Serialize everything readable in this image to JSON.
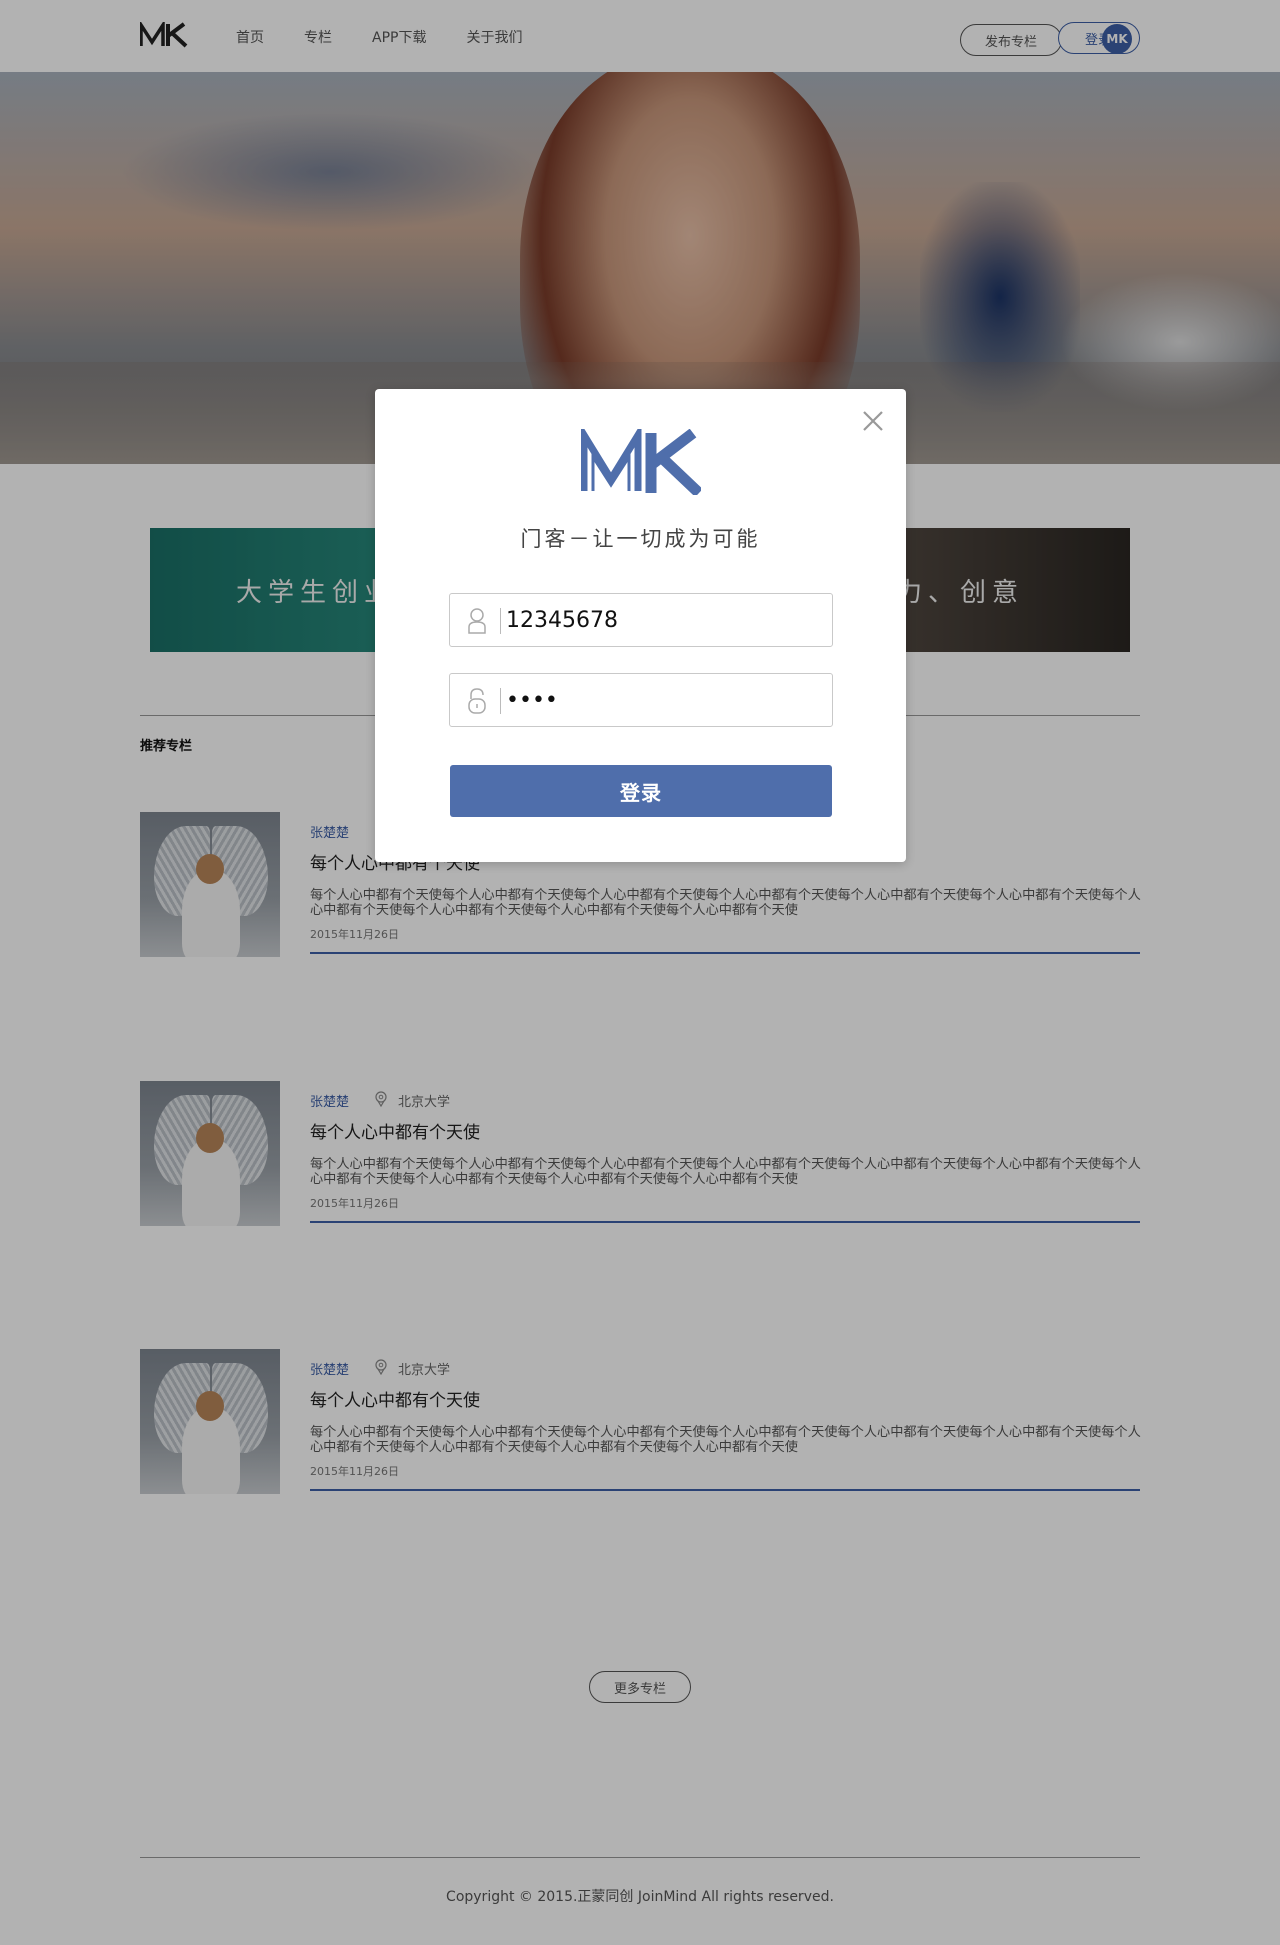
{
  "header": {
    "logo_text": "MK",
    "nav": [
      "首页",
      "专栏",
      "APP下载",
      "关于我们"
    ],
    "publish_label": "发布专栏",
    "login_label": "登录",
    "avatar_text": "MK"
  },
  "banner": {
    "left_text": "大学生创业",
    "right_text": "力、创意"
  },
  "section_title": "推荐专栏",
  "articles": [
    {
      "author": "张楚楚",
      "school": "",
      "title": "每个人心中都有个天使",
      "excerpt": "每个人心中都有个天使每个人心中都有个天使每个人心中都有个天使每个人心中都有个天使每个人心中都有个天使每个人心中都有个天使每个人心中都有个天使每个人心中都有个天使每个人心中都有个天使每个人心中都有个天使",
      "date": "2015年11月26日"
    },
    {
      "author": "张楚楚",
      "school": "北京大学",
      "title": "每个人心中都有个天使",
      "excerpt": "每个人心中都有个天使每个人心中都有个天使每个人心中都有个天使每个人心中都有个天使每个人心中都有个天使每个人心中都有个天使每个人心中都有个天使每个人心中都有个天使每个人心中都有个天使每个人心中都有个天使",
      "date": "2015年11月26日"
    },
    {
      "author": "张楚楚",
      "school": "北京大学",
      "title": "每个人心中都有个天使",
      "excerpt": "每个人心中都有个天使每个人心中都有个天使每个人心中都有个天使每个人心中都有个天使每个人心中都有个天使每个人心中都有个天使每个人心中都有个天使每个人心中都有个天使每个人心中都有个天使每个人心中都有个天使",
      "date": "2015年11月26日"
    }
  ],
  "more_label": "更多专栏",
  "footer": "Copyright © 2015.正蒙同创 JoinMind All rights reserved.",
  "modal": {
    "tagline": "门客－让一切成为可能",
    "username_value": "12345678",
    "password_value": "1234",
    "login_button": "登录",
    "icons": [
      "close-icon",
      "user-icon",
      "lock-icon"
    ]
  },
  "colors": {
    "brand": "#3d5fa6",
    "button": "#4f6eab",
    "overlay": "rgba(0,0,0,0.30)"
  }
}
